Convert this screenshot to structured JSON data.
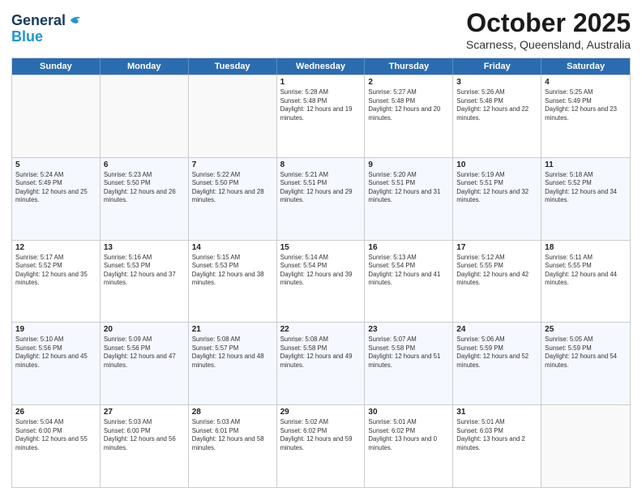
{
  "header": {
    "logo_general": "General",
    "logo_blue": "Blue",
    "month_title": "October 2025",
    "subtitle": "Scarness, Queensland, Australia"
  },
  "weekdays": [
    "Sunday",
    "Monday",
    "Tuesday",
    "Wednesday",
    "Thursday",
    "Friday",
    "Saturday"
  ],
  "weeks": [
    [
      {
        "day": "",
        "sunrise": "",
        "sunset": "",
        "daylight": ""
      },
      {
        "day": "",
        "sunrise": "",
        "sunset": "",
        "daylight": ""
      },
      {
        "day": "",
        "sunrise": "",
        "sunset": "",
        "daylight": ""
      },
      {
        "day": "1",
        "sunrise": "Sunrise: 5:28 AM",
        "sunset": "Sunset: 5:48 PM",
        "daylight": "Daylight: 12 hours and 19 minutes."
      },
      {
        "day": "2",
        "sunrise": "Sunrise: 5:27 AM",
        "sunset": "Sunset: 5:48 PM",
        "daylight": "Daylight: 12 hours and 20 minutes."
      },
      {
        "day": "3",
        "sunrise": "Sunrise: 5:26 AM",
        "sunset": "Sunset: 5:48 PM",
        "daylight": "Daylight: 12 hours and 22 minutes."
      },
      {
        "day": "4",
        "sunrise": "Sunrise: 5:25 AM",
        "sunset": "Sunset: 5:49 PM",
        "daylight": "Daylight: 12 hours and 23 minutes."
      }
    ],
    [
      {
        "day": "5",
        "sunrise": "Sunrise: 5:24 AM",
        "sunset": "Sunset: 5:49 PM",
        "daylight": "Daylight: 12 hours and 25 minutes."
      },
      {
        "day": "6",
        "sunrise": "Sunrise: 5:23 AM",
        "sunset": "Sunset: 5:50 PM",
        "daylight": "Daylight: 12 hours and 26 minutes."
      },
      {
        "day": "7",
        "sunrise": "Sunrise: 5:22 AM",
        "sunset": "Sunset: 5:50 PM",
        "daylight": "Daylight: 12 hours and 28 minutes."
      },
      {
        "day": "8",
        "sunrise": "Sunrise: 5:21 AM",
        "sunset": "Sunset: 5:51 PM",
        "daylight": "Daylight: 12 hours and 29 minutes."
      },
      {
        "day": "9",
        "sunrise": "Sunrise: 5:20 AM",
        "sunset": "Sunset: 5:51 PM",
        "daylight": "Daylight: 12 hours and 31 minutes."
      },
      {
        "day": "10",
        "sunrise": "Sunrise: 5:19 AM",
        "sunset": "Sunset: 5:51 PM",
        "daylight": "Daylight: 12 hours and 32 minutes."
      },
      {
        "day": "11",
        "sunrise": "Sunrise: 5:18 AM",
        "sunset": "Sunset: 5:52 PM",
        "daylight": "Daylight: 12 hours and 34 minutes."
      }
    ],
    [
      {
        "day": "12",
        "sunrise": "Sunrise: 5:17 AM",
        "sunset": "Sunset: 5:52 PM",
        "daylight": "Daylight: 12 hours and 35 minutes."
      },
      {
        "day": "13",
        "sunrise": "Sunrise: 5:16 AM",
        "sunset": "Sunset: 5:53 PM",
        "daylight": "Daylight: 12 hours and 37 minutes."
      },
      {
        "day": "14",
        "sunrise": "Sunrise: 5:15 AM",
        "sunset": "Sunset: 5:53 PM",
        "daylight": "Daylight: 12 hours and 38 minutes."
      },
      {
        "day": "15",
        "sunrise": "Sunrise: 5:14 AM",
        "sunset": "Sunset: 5:54 PM",
        "daylight": "Daylight: 12 hours and 39 minutes."
      },
      {
        "day": "16",
        "sunrise": "Sunrise: 5:13 AM",
        "sunset": "Sunset: 5:54 PM",
        "daylight": "Daylight: 12 hours and 41 minutes."
      },
      {
        "day": "17",
        "sunrise": "Sunrise: 5:12 AM",
        "sunset": "Sunset: 5:55 PM",
        "daylight": "Daylight: 12 hours and 42 minutes."
      },
      {
        "day": "18",
        "sunrise": "Sunrise: 5:11 AM",
        "sunset": "Sunset: 5:55 PM",
        "daylight": "Daylight: 12 hours and 44 minutes."
      }
    ],
    [
      {
        "day": "19",
        "sunrise": "Sunrise: 5:10 AM",
        "sunset": "Sunset: 5:56 PM",
        "daylight": "Daylight: 12 hours and 45 minutes."
      },
      {
        "day": "20",
        "sunrise": "Sunrise: 5:09 AM",
        "sunset": "Sunset: 5:56 PM",
        "daylight": "Daylight: 12 hours and 47 minutes."
      },
      {
        "day": "21",
        "sunrise": "Sunrise: 5:08 AM",
        "sunset": "Sunset: 5:57 PM",
        "daylight": "Daylight: 12 hours and 48 minutes."
      },
      {
        "day": "22",
        "sunrise": "Sunrise: 5:08 AM",
        "sunset": "Sunset: 5:58 PM",
        "daylight": "Daylight: 12 hours and 49 minutes."
      },
      {
        "day": "23",
        "sunrise": "Sunrise: 5:07 AM",
        "sunset": "Sunset: 5:58 PM",
        "daylight": "Daylight: 12 hours and 51 minutes."
      },
      {
        "day": "24",
        "sunrise": "Sunrise: 5:06 AM",
        "sunset": "Sunset: 5:59 PM",
        "daylight": "Daylight: 12 hours and 52 minutes."
      },
      {
        "day": "25",
        "sunrise": "Sunrise: 5:05 AM",
        "sunset": "Sunset: 5:59 PM",
        "daylight": "Daylight: 12 hours and 54 minutes."
      }
    ],
    [
      {
        "day": "26",
        "sunrise": "Sunrise: 5:04 AM",
        "sunset": "Sunset: 6:00 PM",
        "daylight": "Daylight: 12 hours and 55 minutes."
      },
      {
        "day": "27",
        "sunrise": "Sunrise: 5:03 AM",
        "sunset": "Sunset: 6:00 PM",
        "daylight": "Daylight: 12 hours and 56 minutes."
      },
      {
        "day": "28",
        "sunrise": "Sunrise: 5:03 AM",
        "sunset": "Sunset: 6:01 PM",
        "daylight": "Daylight: 12 hours and 58 minutes."
      },
      {
        "day": "29",
        "sunrise": "Sunrise: 5:02 AM",
        "sunset": "Sunset: 6:02 PM",
        "daylight": "Daylight: 12 hours and 59 minutes."
      },
      {
        "day": "30",
        "sunrise": "Sunrise: 5:01 AM",
        "sunset": "Sunset: 6:02 PM",
        "daylight": "Daylight: 13 hours and 0 minutes."
      },
      {
        "day": "31",
        "sunrise": "Sunrise: 5:01 AM",
        "sunset": "Sunset: 6:03 PM",
        "daylight": "Daylight: 13 hours and 2 minutes."
      },
      {
        "day": "",
        "sunrise": "",
        "sunset": "",
        "daylight": ""
      }
    ]
  ]
}
